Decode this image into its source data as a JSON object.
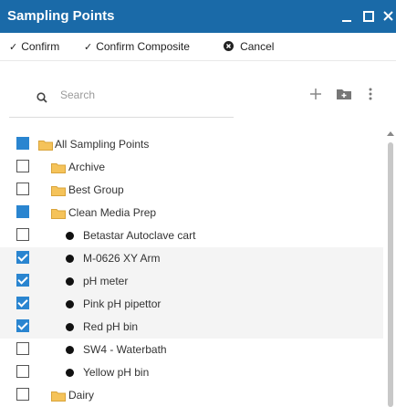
{
  "window": {
    "title": "Sampling Points"
  },
  "toolbar": {
    "confirm": "Confirm",
    "confirm_composite": "Confirm Composite",
    "cancel": "Cancel"
  },
  "search": {
    "placeholder": "Search"
  },
  "icons": {
    "search": "search-icon",
    "add": "plus-icon",
    "folder_add": "folder-add-icon",
    "more": "more-vertical-icon",
    "minimize": "minimize-icon",
    "maximize": "maximize-icon",
    "close": "close-icon"
  },
  "colors": {
    "titlebar": "#1a6aa8",
    "checkbox_checked": "#2a85d0",
    "folder": "#f5c35a"
  },
  "tree": [
    {
      "label": "All Sampling Points",
      "type": "folder",
      "level": 0,
      "state": "partial"
    },
    {
      "label": "Archive",
      "type": "folder",
      "level": 1,
      "state": "unchecked"
    },
    {
      "label": "Best Group",
      "type": "folder",
      "level": 1,
      "state": "unchecked"
    },
    {
      "label": "Clean Media Prep",
      "type": "folder",
      "level": 1,
      "state": "partial"
    },
    {
      "label": "Betastar Autoclave cart",
      "type": "point",
      "level": 2,
      "state": "unchecked"
    },
    {
      "label": "M-0626 XY Arm",
      "type": "point",
      "level": 2,
      "state": "checked"
    },
    {
      "label": "pH meter",
      "type": "point",
      "level": 2,
      "state": "checked"
    },
    {
      "label": "Pink pH pipettor",
      "type": "point",
      "level": 2,
      "state": "checked"
    },
    {
      "label": "Red pH bin",
      "type": "point",
      "level": 2,
      "state": "checked"
    },
    {
      "label": "SW4 - Waterbath",
      "type": "point",
      "level": 2,
      "state": "unchecked"
    },
    {
      "label": "Yellow pH bin",
      "type": "point",
      "level": 2,
      "state": "unchecked"
    },
    {
      "label": "Dairy",
      "type": "folder",
      "level": 1,
      "state": "unchecked"
    }
  ]
}
